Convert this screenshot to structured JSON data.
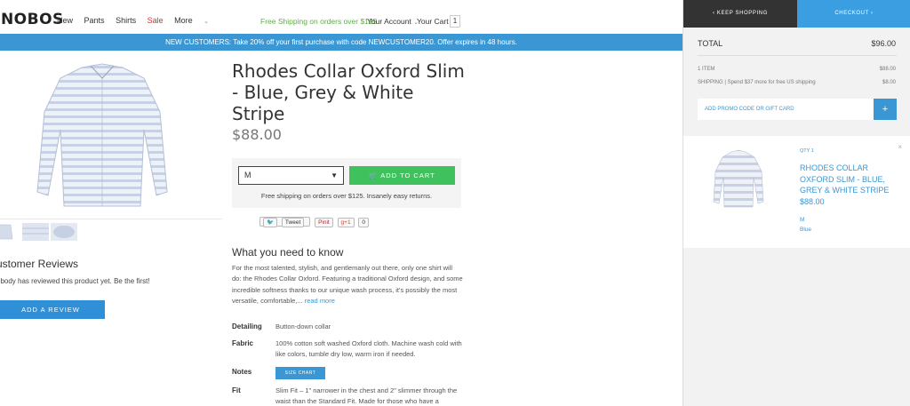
{
  "header": {
    "logo": "ONOBOS",
    "nav": [
      "New",
      "Pants",
      "Shirts",
      "Sale",
      "More"
    ],
    "shipping_note": "Free Shipping on orders over $125",
    "account": "Your Account",
    "cart": "Your Cart",
    "cart_count": "1"
  },
  "promo_banner": "NEW CUSTOMERS: Take 20% off your first purchase with code NEWCUSTOMER20. Offer expires in 48 hours.",
  "product": {
    "title": "Rhodes Collar Oxford Slim - Blue, Grey & White Stripe",
    "price": "$88.00",
    "size": "M",
    "add_to_cart": "ADD TO CART",
    "buy_note": "Free shipping on orders over $125. Insanely easy returns.",
    "social": {
      "tweet": "Tweet",
      "pin": "Pinit",
      "gplus": "g+1",
      "count": "0"
    }
  },
  "reviews": {
    "title": "ustomer Reviews",
    "subtitle": "obody has reviewed this product yet. Be the first!",
    "button": "ADD A REVIEW"
  },
  "details": {
    "heading": "What you need to know",
    "text": "For the most talented, stylish, and gentlemanly out there, only one shirt will do: the Rhodes Collar Oxford. Featuring a traditional Oxford design, and some incredible softness thanks to our unique wash process, it's possibly the most versatile, comfortable,...",
    "read_more": "read more",
    "specs": [
      {
        "label": "Detailing",
        "value": "Button-down collar"
      },
      {
        "label": "Fabric",
        "value": "100% cotton soft washed Oxford cloth. Machine wash cold with like colors, tumble dry low, warm iron if needed."
      },
      {
        "label": "Notes",
        "value": ""
      },
      {
        "label": "Fit",
        "value": "Slim Fit – 1\" narrower in the chest and 2\" slimmer through the waist than the Standard Fit. Made for those who have a slender"
      }
    ],
    "size_chart": "SIZE CHART"
  },
  "sidebar": {
    "keep_shopping": "KEEP SHOPPING",
    "checkout": "CHECKOUT",
    "total_label": "TOTAL",
    "total_value": "$96.00",
    "items_label": "1 ITEM",
    "items_value": "$88.00",
    "shipping_label": "SHIPPING | Spend $37 more for free US shipping",
    "shipping_value": "$8.00",
    "promo_placeholder": "ADD PROMO CODE OR GIFT CARD",
    "promo_plus": "+",
    "item": {
      "qty": "QTY 1",
      "name": "RHODES COLLAR OXFORD SLIM - BLUE, GREY & WHITE STRIPE",
      "price": "$88.00",
      "size": "M",
      "color": "Blue",
      "close": "×"
    }
  },
  "colors": {
    "accent_blue": "#3b97d3",
    "green": "#3fc25d",
    "sale_red": "#d0342c"
  }
}
